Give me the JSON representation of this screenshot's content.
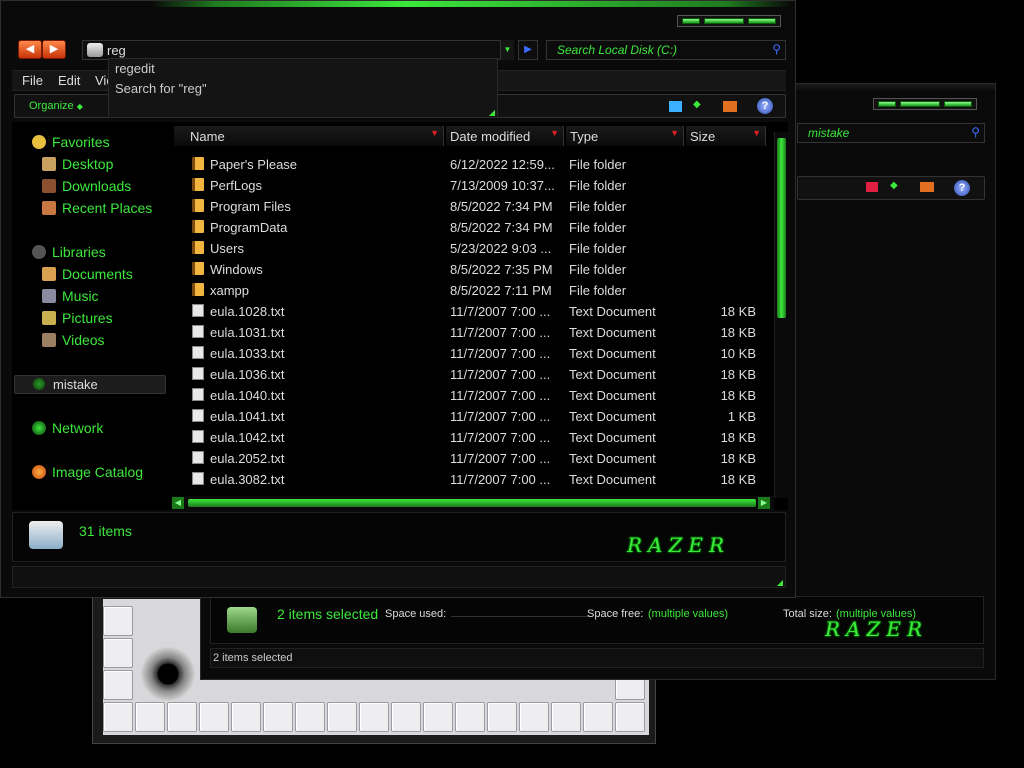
{
  "address": {
    "value": "reg",
    "suggestions": [
      "regedit",
      "Search for \"reg\""
    ]
  },
  "search": {
    "main_placeholder": "Search Local Disk (C:)",
    "back_placeholder": "mistake"
  },
  "menu": {
    "file": "File",
    "edit": "Edit",
    "view": "Vie"
  },
  "toolbar": {
    "organize": "Organize"
  },
  "nav": {
    "favorites": "Favorites",
    "desktop": "Desktop",
    "downloads": "Downloads",
    "recent": "Recent Places",
    "libraries": "Libraries",
    "documents": "Documents",
    "music": "Music",
    "pictures": "Pictures",
    "videos": "Videos",
    "homegroup": "mistake",
    "network": "Network",
    "image_catalog": "Image Catalog"
  },
  "columns": {
    "name": "Name",
    "date": "Date modified",
    "type": "Type",
    "size": "Size"
  },
  "files": [
    {
      "name": "Paper's Please",
      "date": "6/12/2022 12:59...",
      "type": "File folder",
      "size": "",
      "kind": "folder"
    },
    {
      "name": "PerfLogs",
      "date": "7/13/2009 10:37...",
      "type": "File folder",
      "size": "",
      "kind": "folder"
    },
    {
      "name": "Program Files",
      "date": "8/5/2022 7:34 PM",
      "type": "File folder",
      "size": "",
      "kind": "folder"
    },
    {
      "name": "ProgramData",
      "date": "8/5/2022 7:34 PM",
      "type": "File folder",
      "size": "",
      "kind": "folder"
    },
    {
      "name": "Users",
      "date": "5/23/2022 9:03 ...",
      "type": "File folder",
      "size": "",
      "kind": "folder"
    },
    {
      "name": "Windows",
      "date": "8/5/2022 7:35 PM",
      "type": "File folder",
      "size": "",
      "kind": "folder"
    },
    {
      "name": "xampp",
      "date": "8/5/2022 7:11 PM",
      "type": "File folder",
      "size": "",
      "kind": "folder"
    },
    {
      "name": "eula.1028.txt",
      "date": "11/7/2007 7:00 ...",
      "type": "Text Document",
      "size": "18 KB",
      "kind": "doc"
    },
    {
      "name": "eula.1031.txt",
      "date": "11/7/2007 7:00 ...",
      "type": "Text Document",
      "size": "18 KB",
      "kind": "doc"
    },
    {
      "name": "eula.1033.txt",
      "date": "11/7/2007 7:00 ...",
      "type": "Text Document",
      "size": "10 KB",
      "kind": "doc"
    },
    {
      "name": "eula.1036.txt",
      "date": "11/7/2007 7:00 ...",
      "type": "Text Document",
      "size": "18 KB",
      "kind": "doc"
    },
    {
      "name": "eula.1040.txt",
      "date": "11/7/2007 7:00 ...",
      "type": "Text Document",
      "size": "18 KB",
      "kind": "doc"
    },
    {
      "name": "eula.1041.txt",
      "date": "11/7/2007 7:00 ...",
      "type": "Text Document",
      "size": "1 KB",
      "kind": "doc"
    },
    {
      "name": "eula.1042.txt",
      "date": "11/7/2007 7:00 ...",
      "type": "Text Document",
      "size": "18 KB",
      "kind": "doc"
    },
    {
      "name": "eula.2052.txt",
      "date": "11/7/2007 7:00 ...",
      "type": "Text Document",
      "size": "18 KB",
      "kind": "doc"
    },
    {
      "name": "eula.3082.txt",
      "date": "11/7/2007 7:00 ...",
      "type": "Text Document",
      "size": "18 KB",
      "kind": "doc"
    }
  ],
  "details1": {
    "count": "31 items"
  },
  "details2": {
    "selected": "2 items selected",
    "space_used_label": "Space used:",
    "space_free_label": "Space free:",
    "space_free_value": "(multiple values)",
    "total_size_label": "Total size:",
    "total_size_value": "(multiple values)",
    "status": "2 items selected"
  },
  "brand": "RAZER",
  "colors": {
    "accent": "#3ce83c",
    "background": "#0a0a0a",
    "sort_arrow": "#e02020"
  }
}
